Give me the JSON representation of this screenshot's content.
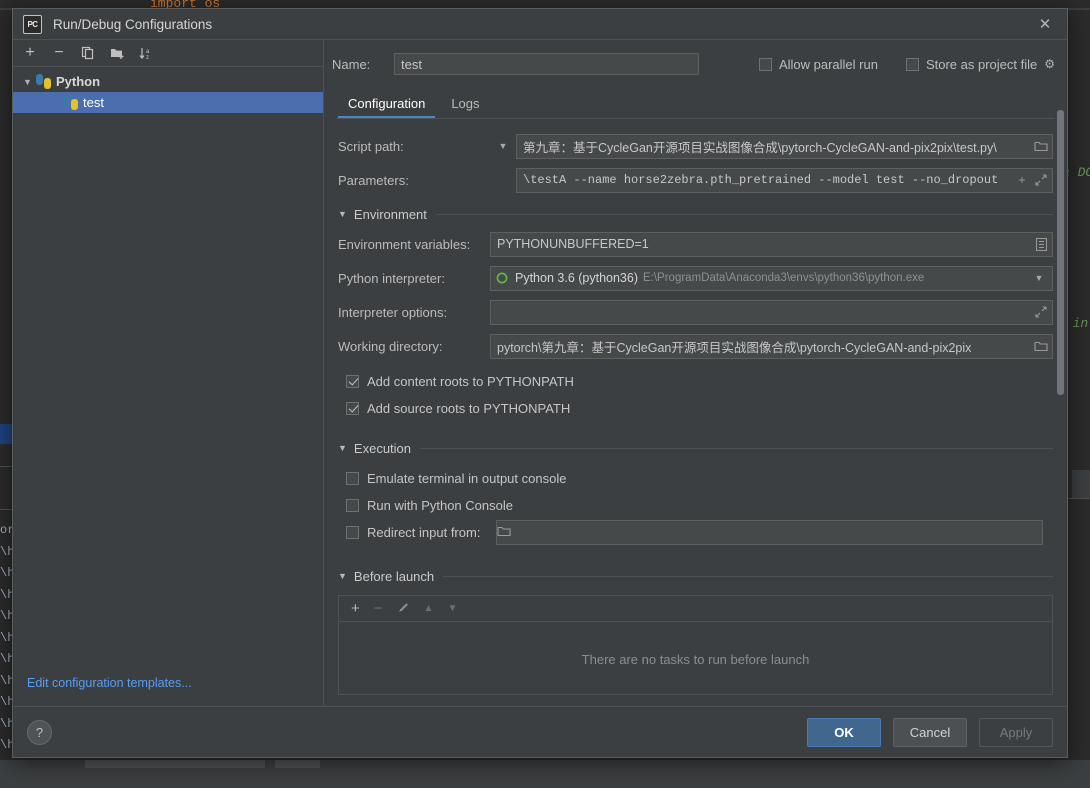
{
  "background": {
    "top_code": "import os",
    "right_code_1": "a DO",
    "right_code_2": "; in",
    "left_lines": [
      "or",
      "\\h",
      "\\h",
      "\\h",
      "\\h",
      "\\h",
      "\\h",
      "\\h",
      "\\h",
      "\\h",
      "\\h",
      "\\h"
    ]
  },
  "window": {
    "logo_text": "PC",
    "title": "Run/Debug Configurations",
    "close_icon": "close-icon"
  },
  "left_panel": {
    "toolbar": [
      {
        "name": "add-configuration-button",
        "glyph": "+"
      },
      {
        "name": "remove-configuration-button",
        "glyph": "−"
      },
      {
        "name": "copy-configuration-button",
        "glyph": "❐"
      },
      {
        "name": "new-folder-button",
        "glyph": "▰"
      },
      {
        "name": "sort-configurations-button",
        "glyph": "↓"
      }
    ],
    "tree": {
      "group_label": "Python",
      "child_label": "test"
    },
    "edit_templates_link": "Edit configuration templates..."
  },
  "name_row": {
    "label": "Name:",
    "value": "test",
    "allow_parallel_run": {
      "label": "Allow parallel run",
      "checked": false
    },
    "store_as_project_file": {
      "label": "Store as project file",
      "checked": false
    },
    "gear_icon": "gear-icon"
  },
  "tabs": [
    {
      "label": "Configuration",
      "active": true
    },
    {
      "label": "Logs",
      "active": false
    }
  ],
  "configuration": {
    "script_path": {
      "label": "Script path:",
      "value": "\\第九章：基于CycleGan开源项目实战图像合成\\pytorch-CycleGAN-and-pix2pix\\test.py",
      "browse_icon": "folder-icon"
    },
    "parameters": {
      "label": "Parameters:",
      "value": "\\testA --name horse2zebra.pth_pretrained --model test --no_dropout",
      "macro_icon": "plus-icon",
      "expand_icon": "expand-icon"
    },
    "environment_section": {
      "title": "Environment",
      "env_vars": {
        "label": "Environment variables:",
        "value": "PYTHONUNBUFFERED=1",
        "edit_icon": "list-edit-icon"
      },
      "python_interpreter": {
        "label": "Python interpreter:",
        "value": "Python 3.6 (python36)",
        "path": "E:\\ProgramData\\Anaconda3\\envs\\python36\\python.exe",
        "dropdown_icon": "chevron-down-icon"
      },
      "interpreter_options": {
        "label": "Interpreter options:",
        "value": "",
        "expand_icon": "expand-icon"
      },
      "working_directory": {
        "label": "Working directory:",
        "value": "pytorch\\第九章：基于CycleGan开源项目实战图像合成\\pytorch-CycleGAN-and-pix2pix",
        "browse_icon": "folder-icon"
      },
      "add_content_roots": {
        "label": "Add content roots to PYTHONPATH",
        "checked": true
      },
      "add_source_roots": {
        "label": "Add source roots to PYTHONPATH",
        "checked": true
      }
    },
    "execution_section": {
      "title": "Execution",
      "emulate_terminal": {
        "label": "Emulate terminal in output console",
        "checked": false
      },
      "run_with_python_console": {
        "label": "Run with Python Console",
        "checked": false
      },
      "redirect_input": {
        "label": "Redirect input from:",
        "checked": false,
        "value": "",
        "browse_icon": "folder-icon"
      }
    },
    "before_launch": {
      "title": "Before launch",
      "toolbar": [
        {
          "name": "before-launch-add-button",
          "glyph": "+",
          "enabled": true
        },
        {
          "name": "before-launch-remove-button",
          "glyph": "−",
          "enabled": false
        },
        {
          "name": "before-launch-edit-button",
          "glyph": "✎",
          "enabled": false
        },
        {
          "name": "before-launch-move-up-button",
          "glyph": "▲",
          "enabled": false
        },
        {
          "name": "before-launch-move-down-button",
          "glyph": "▼",
          "enabled": false
        }
      ],
      "empty_text": "There are no tasks to run before launch"
    }
  },
  "footer": {
    "help_label": "?",
    "ok_label": "OK",
    "cancel_label": "Cancel",
    "apply_label": "Apply"
  },
  "colors": {
    "dialog_bg": "#3c3f41",
    "field_bg": "#45494a",
    "accent_blue": "#4b6eaf",
    "tab_underline": "#4a88c7",
    "link": "#589df6",
    "ok_button": "#41678f"
  }
}
